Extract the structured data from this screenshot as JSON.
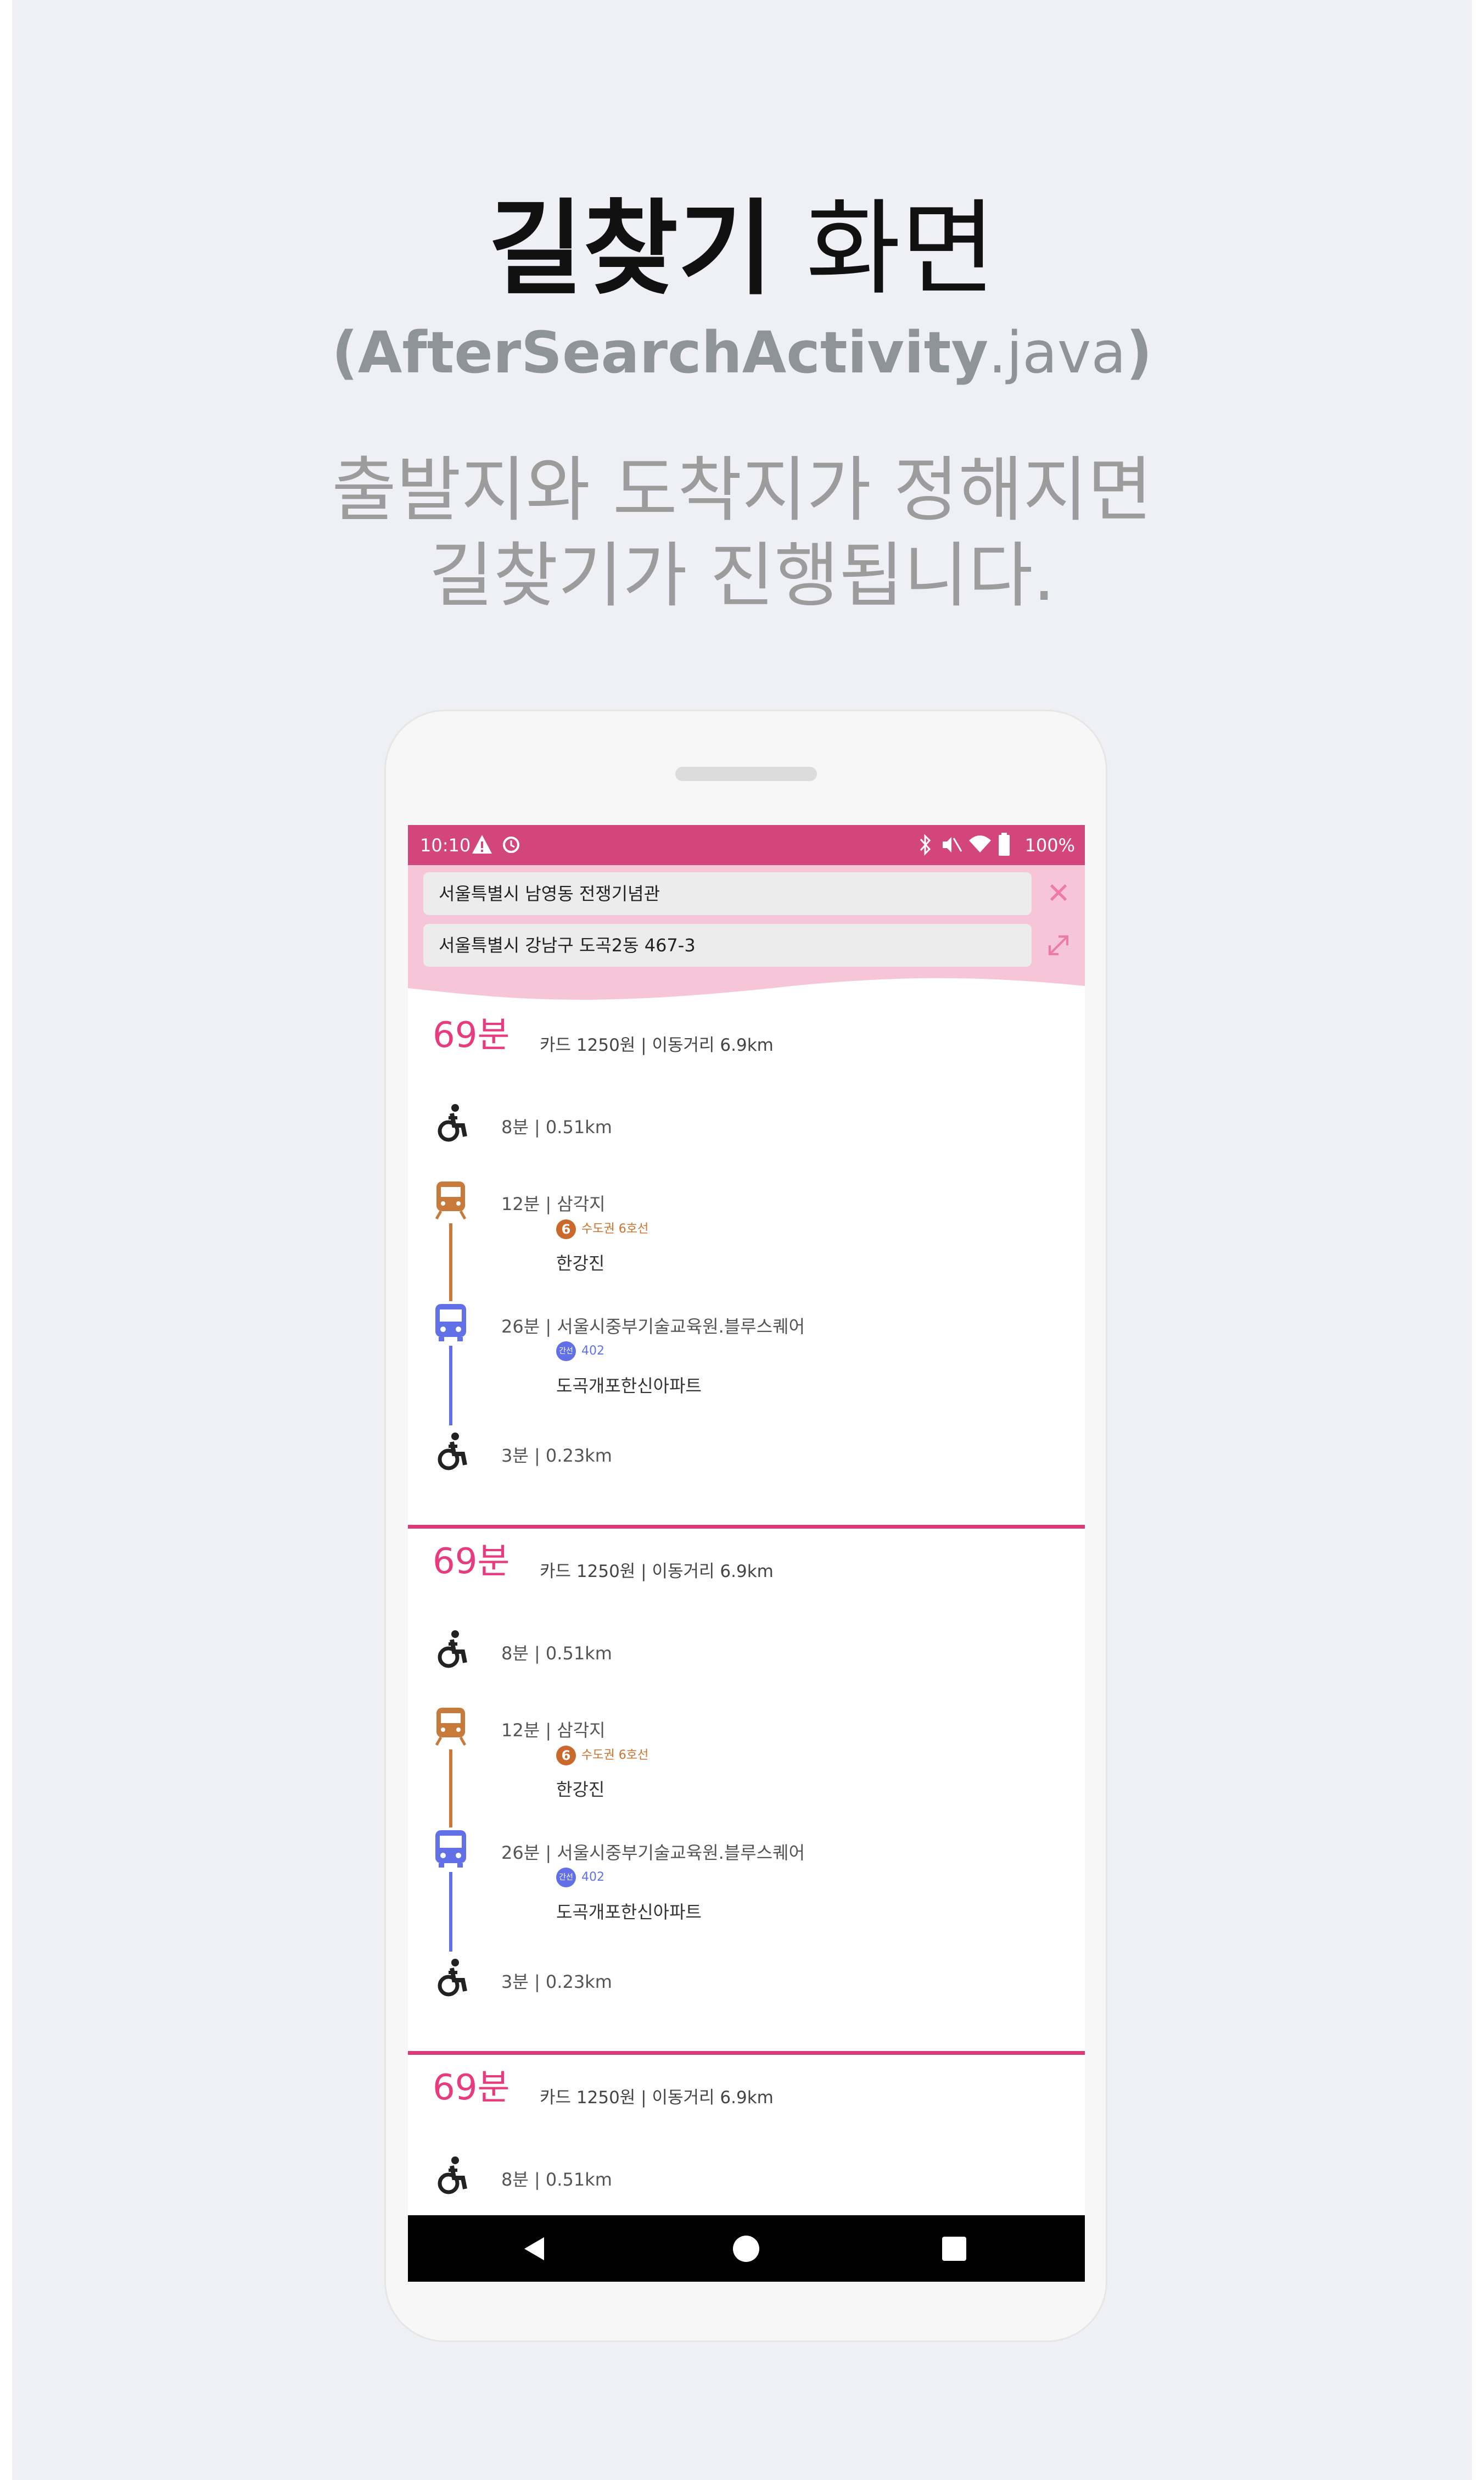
{
  "heading": {
    "title_bold": "길찾기",
    "title_light": "화면",
    "subtitle_open": "(",
    "subtitle_class": "AfterSearchActivity",
    "subtitle_ext": ".java",
    "subtitle_close": ")",
    "desc_line1": "출발지와 도착지가 정해지면",
    "desc_line2": "길찾기가 진행됩니다."
  },
  "statusbar": {
    "time": "10:10",
    "battery": "100%",
    "icons": [
      "warning-icon",
      "sync-icon",
      "bluetooth-icon",
      "mute-icon",
      "wifi-icon",
      "battery-icon"
    ]
  },
  "search": {
    "origin": "서울특별시 남영동 전쟁기념관",
    "destination": "서울특별시 강남구 도곡2동 467-3",
    "clear_icon": "close-icon",
    "swap_icon": "expand-icon"
  },
  "colors": {
    "accent": "#e83a7e",
    "statusbar": "#d3467c",
    "header_bg": "#f6c6d8",
    "subway": "#c77a3a",
    "bus": "#6270e8"
  },
  "routes": [
    {
      "time": "69분",
      "info": "카드 1250원 | 이동거리 6.9km",
      "segments": [
        {
          "type": "walk",
          "text": "8분 | 0.51km"
        },
        {
          "type": "subway",
          "text": "12분 | 삼각지",
          "line_badge": "6",
          "line_name": "수도권 6호선",
          "stop": "한강진"
        },
        {
          "type": "bus",
          "text": "26분 | 서울시중부기술교육원.블루스퀘어",
          "line_badge": "간선",
          "line_name": "402",
          "stop": "도곡개포한신아파트"
        },
        {
          "type": "walk",
          "text": "3분 | 0.23km"
        }
      ]
    },
    {
      "time": "69분",
      "info": "카드 1250원 | 이동거리 6.9km",
      "segments": [
        {
          "type": "walk",
          "text": "8분 | 0.51km"
        },
        {
          "type": "subway",
          "text": "12분 | 삼각지",
          "line_badge": "6",
          "line_name": "수도권 6호선",
          "stop": "한강진"
        },
        {
          "type": "bus",
          "text": "26분 | 서울시중부기술교육원.블루스퀘어",
          "line_badge": "간선",
          "line_name": "402",
          "stop": "도곡개포한신아파트"
        },
        {
          "type": "walk",
          "text": "3분 | 0.23km"
        }
      ]
    },
    {
      "time": "69분",
      "info": "카드 1250원 | 이동거리 6.9km",
      "segments": [
        {
          "type": "walk",
          "text": "8분 | 0.51km"
        }
      ]
    }
  ],
  "navbar": {
    "back_icon": "back-triangle-icon",
    "home_icon": "home-circle-icon",
    "recents_icon": "recents-square-icon"
  }
}
